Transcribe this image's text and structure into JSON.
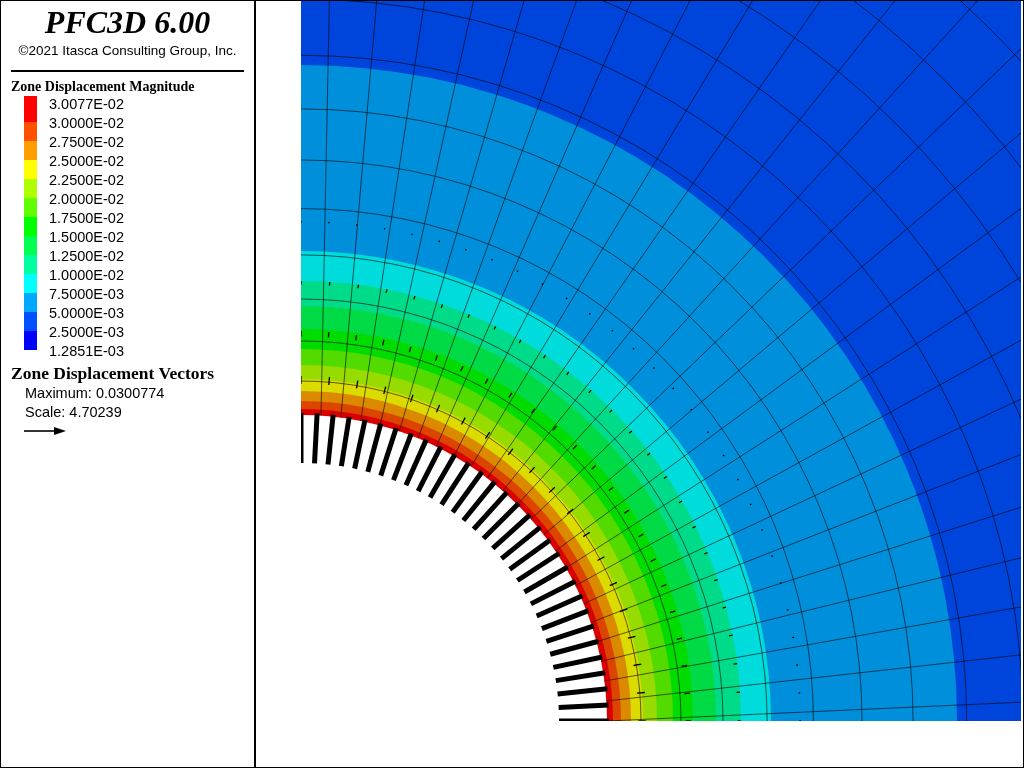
{
  "title": "PFC3D 6.00",
  "copyright": "©2021 Itasca Consulting Group, Inc.",
  "contour_legend": {
    "title": "Zone Displacement Magnitude",
    "labels": [
      "3.0077E-02",
      "3.0000E-02",
      "2.7500E-02",
      "2.5000E-02",
      "2.2500E-02",
      "2.0000E-02",
      "1.7500E-02",
      "1.5000E-02",
      "1.2500E-02",
      "1.0000E-02",
      "7.5000E-03",
      "5.0000E-03",
      "2.5000E-03",
      "1.2851E-03"
    ],
    "bands": [
      {
        "color": "#ff0000"
      },
      {
        "color": "#ff5000"
      },
      {
        "color": "#ffa000"
      },
      {
        "color": "#ffff00"
      },
      {
        "color": "#b0ff00"
      },
      {
        "color": "#60ff00"
      },
      {
        "color": "#00ff00"
      },
      {
        "color": "#00ff50"
      },
      {
        "color": "#00ffa0"
      },
      {
        "color": "#00ffff"
      },
      {
        "color": "#00a8ff"
      },
      {
        "color": "#0050ff"
      },
      {
        "color": "#0000ff"
      }
    ]
  },
  "vector_legend": {
    "title": "Zone Displacement Vectors",
    "maximum": "Maximum: 0.0300774",
    "scale": "Scale: 4.70239"
  }
}
